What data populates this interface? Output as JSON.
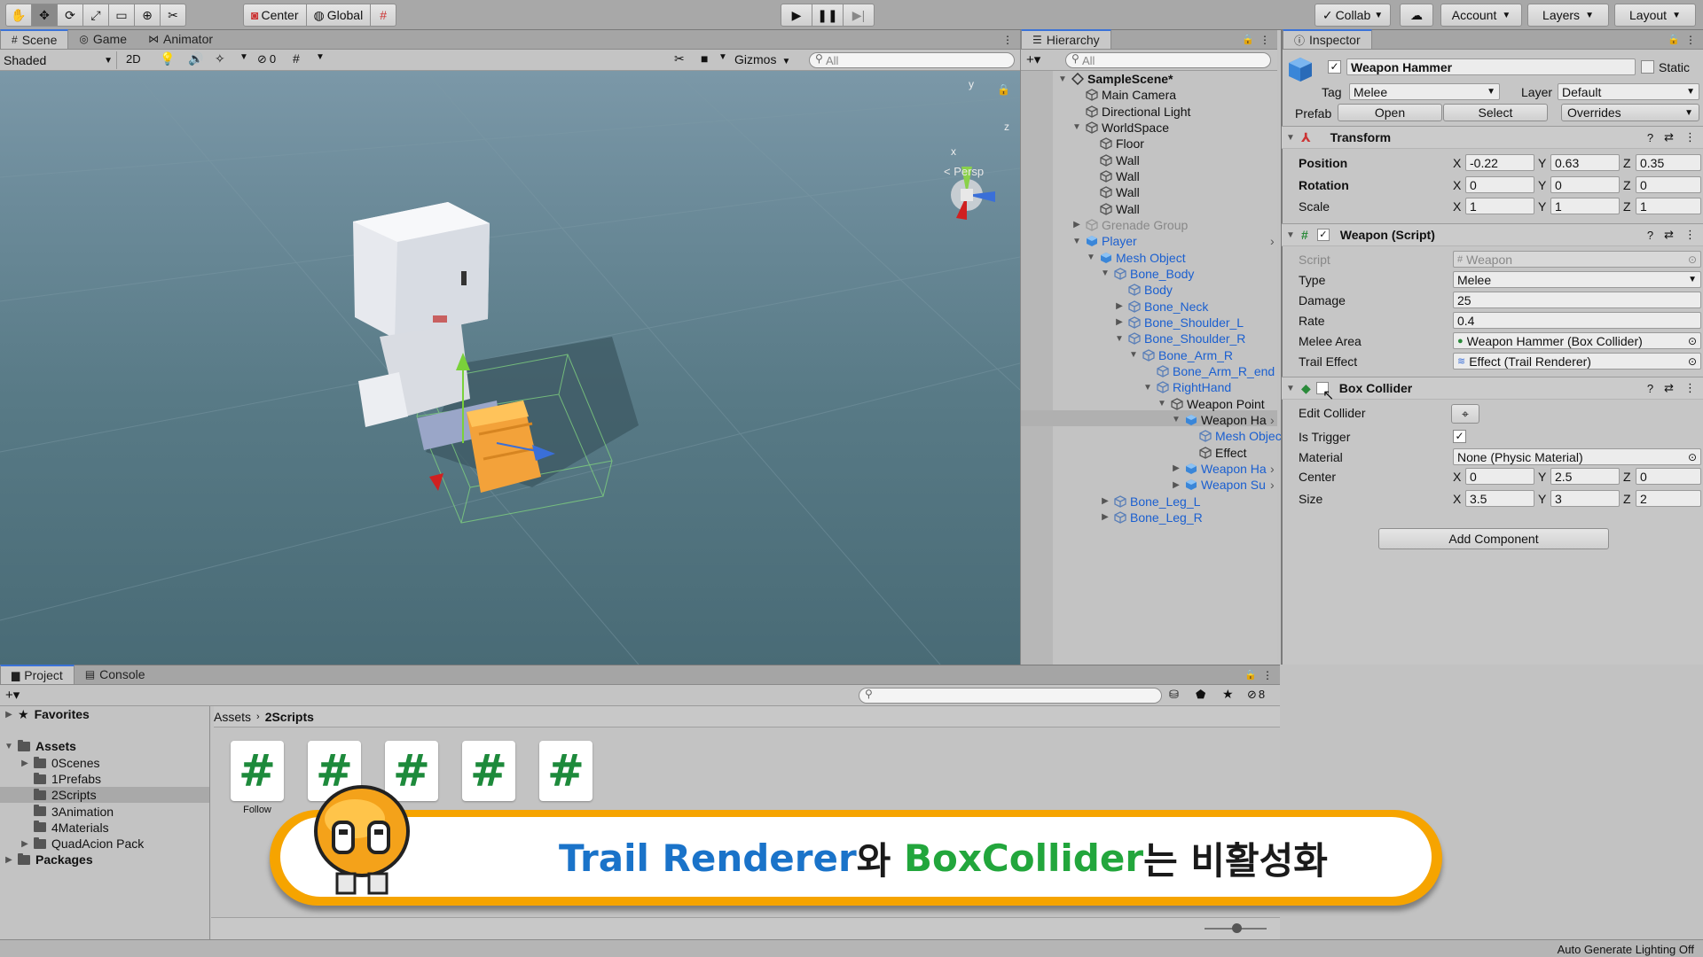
{
  "toolbar": {
    "pivot_label": "Center",
    "space_label": "Global",
    "collab_label": "Collab",
    "account_label": "Account",
    "layers_label": "Layers",
    "layout_label": "Layout"
  },
  "scene_panel": {
    "tabs": [
      "Scene",
      "Game",
      "Animator"
    ],
    "shading_mode": "Shaded",
    "mode_2d": "2D",
    "hidden_count": "0",
    "gizmos_label": "Gizmos",
    "search_placeholder": "All",
    "axis_x": "x",
    "axis_y": "y",
    "axis_z": "z",
    "persp_label": "< Persp"
  },
  "hierarchy": {
    "title": "Hierarchy",
    "search_placeholder": "All",
    "items": [
      {
        "label": "SampleScene*"
      },
      {
        "label": "Main Camera"
      },
      {
        "label": "Directional Light"
      },
      {
        "label": "WorldSpace"
      },
      {
        "label": "Floor"
      },
      {
        "label": "Wall"
      },
      {
        "label": "Wall"
      },
      {
        "label": "Wall"
      },
      {
        "label": "Wall"
      },
      {
        "label": "Grenade Group"
      },
      {
        "label": "Player"
      },
      {
        "label": "Mesh Object"
      },
      {
        "label": "Bone_Body"
      },
      {
        "label": "Body"
      },
      {
        "label": "Bone_Neck"
      },
      {
        "label": "Bone_Shoulder_L"
      },
      {
        "label": "Bone_Shoulder_R"
      },
      {
        "label": "Bone_Arm_R"
      },
      {
        "label": "Bone_Arm_R_end"
      },
      {
        "label": "RightHand"
      },
      {
        "label": "Weapon Point"
      },
      {
        "label": "Weapon Ha"
      },
      {
        "label": "Mesh Objec"
      },
      {
        "label": "Effect"
      },
      {
        "label": "Weapon Ha"
      },
      {
        "label": "Weapon Su"
      },
      {
        "label": "Bone_Leg_L"
      },
      {
        "label": "Bone_Leg_R"
      }
    ]
  },
  "inspector": {
    "title": "Inspector",
    "object_name": "Weapon Hammer",
    "static_label": "Static",
    "tag_label": "Tag",
    "tag_value": "Melee",
    "layer_label": "Layer",
    "layer_value": "Default",
    "prefab_label": "Prefab",
    "open_label": "Open",
    "select_label": "Select",
    "overrides_label": "Overrides",
    "transform": {
      "title": "Transform",
      "position_label": "Position",
      "rotation_label": "Rotation",
      "scale_label": "Scale",
      "position": {
        "x": "-0.22",
        "y": "0.63",
        "z": "0.35"
      },
      "rotation": {
        "x": "0",
        "y": "0",
        "z": "0"
      },
      "scale": {
        "x": "1",
        "y": "1",
        "z": "1"
      }
    },
    "weapon_script": {
      "title": "Weapon (Script)",
      "script_label": "Script",
      "script_value": "Weapon",
      "type_label": "Type",
      "type_value": "Melee",
      "damage_label": "Damage",
      "damage_value": "25",
      "rate_label": "Rate",
      "rate_value": "0.4",
      "melee_area_label": "Melee Area",
      "melee_area_value": "Weapon Hammer (Box Collider)",
      "trail_effect_label": "Trail Effect",
      "trail_effect_value": "Effect (Trail Renderer)"
    },
    "box_collider": {
      "title": "Box Collider",
      "edit_collider_label": "Edit Collider",
      "is_trigger_label": "Is Trigger",
      "material_label": "Material",
      "material_value": "None (Physic Material)",
      "center_label": "Center",
      "center": {
        "x": "0",
        "y": "2.5",
        "z": "0"
      },
      "size_label": "Size",
      "size": {
        "x": "3.5",
        "y": "3",
        "z": "2"
      }
    },
    "add_component_label": "Add Component"
  },
  "project": {
    "tabs": [
      "Project",
      "Console"
    ],
    "hidden_count": "8",
    "favorites_label": "Favorites",
    "assets_label": "Assets",
    "folders": [
      "0Scenes",
      "1Prefabs",
      "2Scripts",
      "3Animation",
      "4Materials",
      "QuadAcion Pack"
    ],
    "packages_label": "Packages",
    "breadcrumb_root": "Assets",
    "breadcrumb_current": "2Scripts",
    "scripts": [
      {
        "label": "Follow"
      },
      {
        "label": ""
      },
      {
        "label": ""
      },
      {
        "label": ""
      },
      {
        "label": ""
      }
    ]
  },
  "caption": {
    "part1": "Trail Renderer",
    "part2": "와 ",
    "part3": "BoxCollider",
    "part4": "는 비활성화",
    "color_blue": "#1a73c9",
    "color_green": "#22a63c"
  },
  "status_bar": {
    "text": "Auto Generate Lighting Off"
  }
}
